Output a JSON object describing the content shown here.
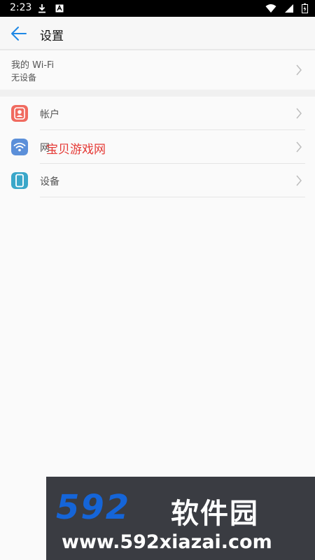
{
  "status_bar": {
    "time": "2:23",
    "left_icons": [
      "download-icon",
      "notification-icon"
    ],
    "right_icons": [
      "wifi-icon",
      "signal-icon",
      "battery-icon"
    ]
  },
  "app_bar": {
    "title": "设置",
    "back_icon": "back-arrow-icon"
  },
  "wifi_section": {
    "title": "我的 Wi-Fi",
    "subtitle": "无设备"
  },
  "menu_items": [
    {
      "label": "帐户",
      "icon": "account-icon",
      "icon_color": "#f06a5f"
    },
    {
      "label": "网",
      "icon": "wifi-network-icon",
      "icon_color": "#5b8fd9"
    },
    {
      "label": "设备",
      "icon": "device-icon",
      "icon_color": "#3aa7c9"
    }
  ],
  "watermark_red": "宝贝游戏网",
  "banner": {
    "brand_number": "592",
    "brand_text": "软件园",
    "url": "www.592xiazai.com"
  },
  "colors": {
    "accent": "#1e88e5",
    "background": "#fafafa",
    "banner_bg": "#3a3c42",
    "brand_blue": "#1565d8"
  }
}
